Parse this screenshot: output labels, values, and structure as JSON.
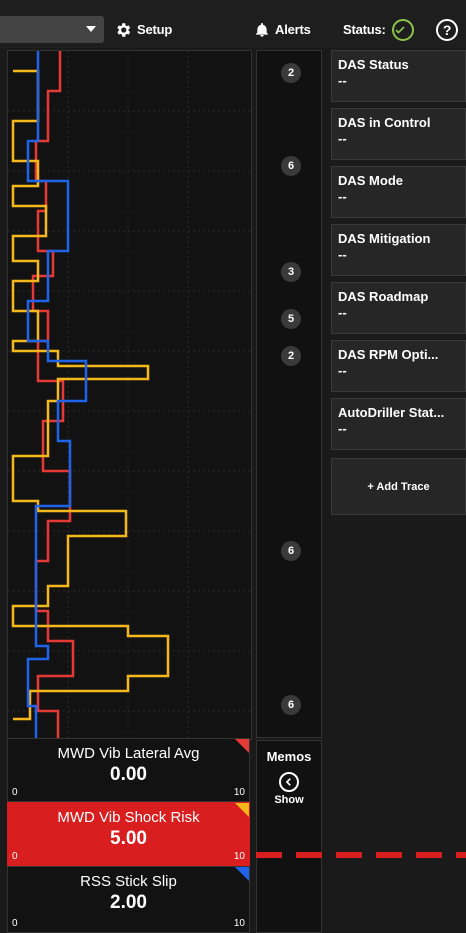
{
  "topbar": {
    "setup_label": "Setup",
    "alerts_label": "Alerts",
    "status_label": "Status:",
    "help_label": "?"
  },
  "memos": {
    "badges": [
      "2",
      "6",
      "3",
      "5",
      "2",
      "6",
      "6"
    ],
    "title": "Memos",
    "show_label": "Show"
  },
  "panels": [
    {
      "title": "DAS Status",
      "value": "--"
    },
    {
      "title": "DAS in Control",
      "value": "--"
    },
    {
      "title": "DAS Mode",
      "value": "--"
    },
    {
      "title": "DAS Mitigation",
      "value": "--"
    },
    {
      "title": "DAS Roadmap",
      "value": "--"
    },
    {
      "title": "DAS RPM Opti...",
      "value": "--"
    },
    {
      "title": "AutoDriller Stat...",
      "value": "--"
    }
  ],
  "add_trace_label": "+ Add Trace",
  "gauges": [
    {
      "title": "MWD Vib Lateral Avg",
      "value": "0.00",
      "min": "0",
      "max": "10",
      "corner_color": "#e53935"
    },
    {
      "title": "MWD Vib Shock Risk",
      "value": "5.00",
      "min": "0",
      "max": "10",
      "corner_color": "#f5b81c"
    },
    {
      "title": "RSS Stick Slip",
      "value": "2.00",
      "min": "0",
      "max": "10",
      "corner_color": "#1e63e9"
    }
  ],
  "colors": {
    "red_trace": "#e53935",
    "yellow_trace": "#f5b81c",
    "blue_trace": "#1e63e9",
    "alert_bg": "#d81e1e",
    "status_ok": "#8bc34a"
  }
}
